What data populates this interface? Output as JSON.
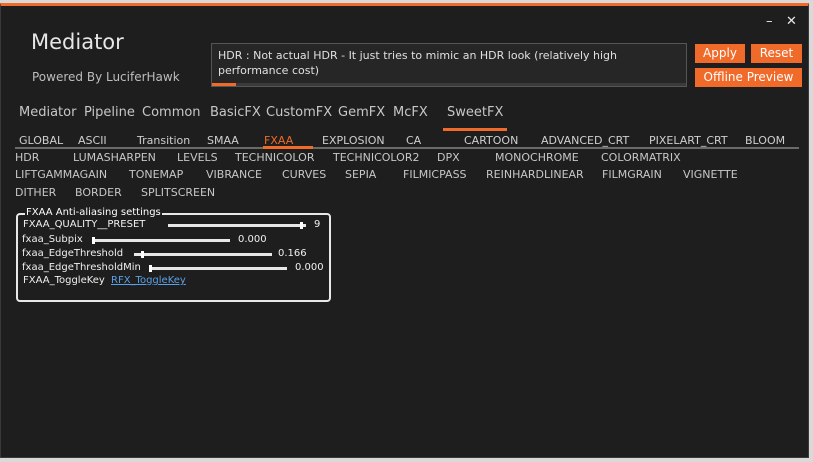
{
  "window": {
    "title": "Mediator",
    "subtitle": "Powered By LuciferHawk",
    "minimize_glyph": "–",
    "close_glyph": "✕",
    "accent_color": "#f06a2a"
  },
  "description": {
    "text": "HDR : Not actual HDR - It just tries to mimic an HDR look (relatively high performance cost)",
    "progress": 0.05
  },
  "buttons": {
    "apply": "Apply",
    "reset": "Reset",
    "offline_preview": "Offline Preview"
  },
  "main_tabs": [
    "Mediator",
    "Pipeline",
    "Common",
    "BasicFX",
    "CustomFX",
    "GemFX",
    "McFX",
    "SweetFX"
  ],
  "main_tab_selected": "SweetFX",
  "sub_tabs": [
    "GLOBAL",
    "ASCII",
    "Transition",
    "SMAA",
    "FXAA",
    "EXPLOSION",
    "CA",
    "CARTOON",
    "ADVANCED_CRT",
    "PIXELART_CRT",
    "BLOOM"
  ],
  "sub_tab_selected": "FXAA",
  "effects_rows": [
    [
      "HDR",
      "LUMASHARPEN",
      "LEVELS",
      "TECHNICOLOR",
      "TECHNICOLOR2",
      "DPX",
      "MONOCHROME",
      "COLORMATRIX"
    ],
    [
      "LIFTGAMMAGAIN",
      "TONEMAP",
      "VIBRANCE",
      "CURVES",
      "SEPIA",
      "FILMICPASS",
      "REINHARDLINEAR",
      "FILMGRAIN",
      "VIGNETTE"
    ],
    [
      "DITHER",
      "BORDER",
      "SPLITSCREEN"
    ]
  ],
  "settings": {
    "title": "FXAA Anti-aliasing settings",
    "rows": [
      {
        "label": "FXAA_QUALITY__PRESET",
        "value": "9",
        "fraction": 0.98
      },
      {
        "label": "fxaa_Subpix",
        "value": "0.000",
        "fraction": 0.0
      },
      {
        "label": "fxaa_EdgeThreshold",
        "value": "0.166",
        "fraction": 0.05
      },
      {
        "label": "fxaa_EdgeThresholdMin",
        "value": "0.000",
        "fraction": 0.0
      }
    ],
    "toggle_label": "FXAA_ToggleKey",
    "toggle_value": "RFX_ToggleKey"
  }
}
